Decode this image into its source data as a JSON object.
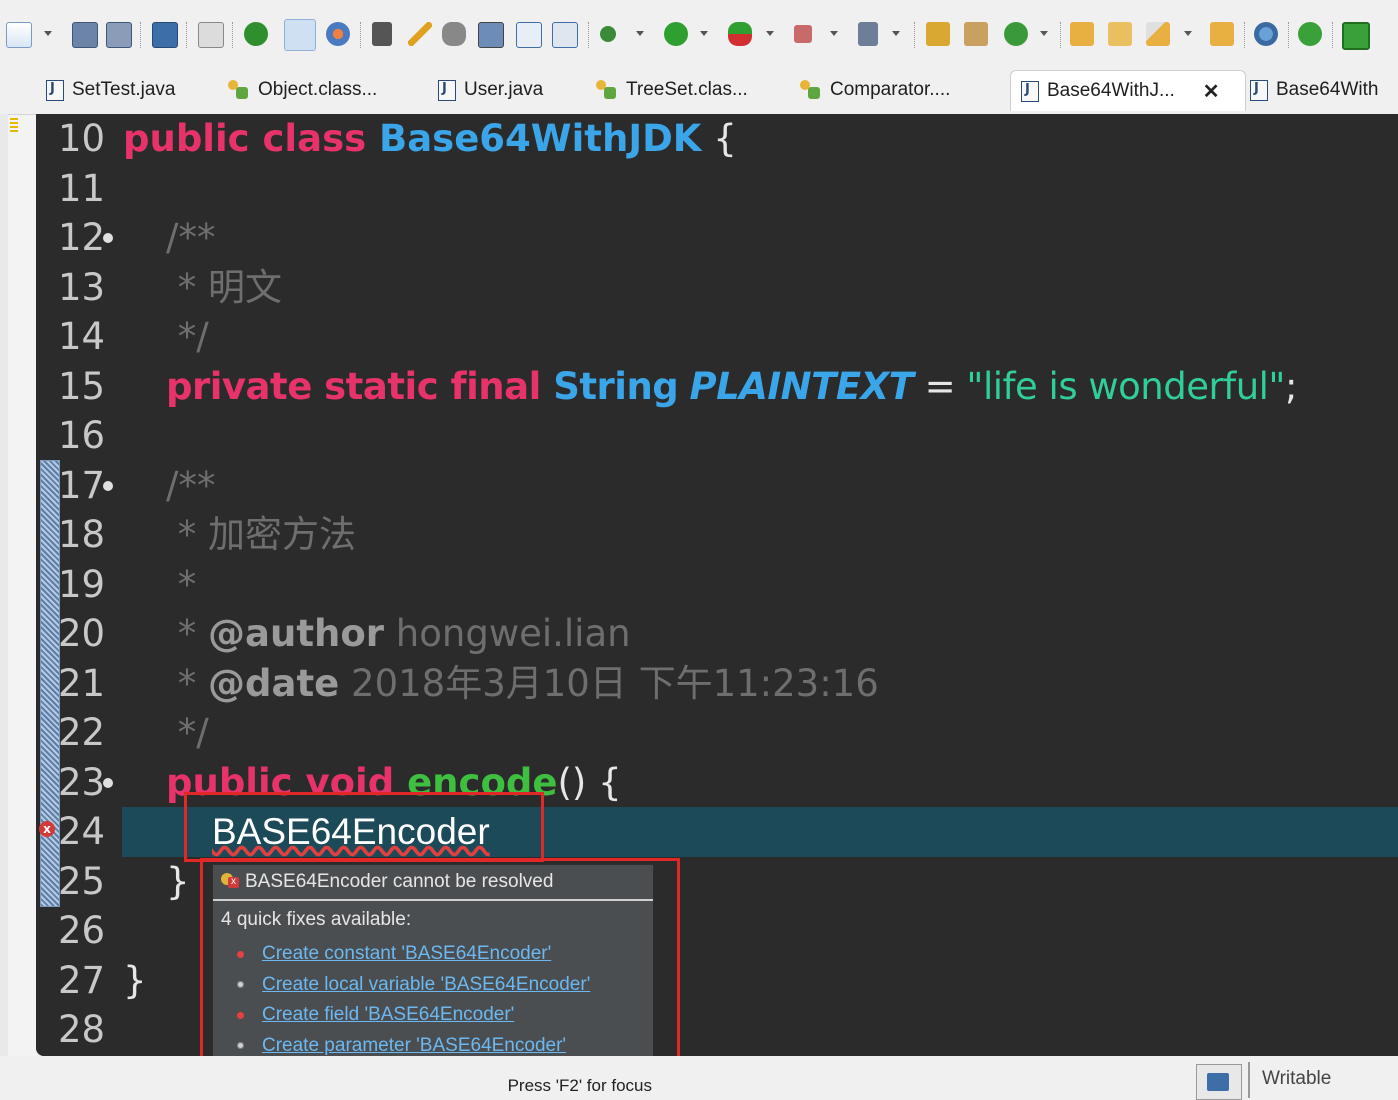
{
  "toolbar": {
    "icons": [
      "new-icon",
      "save-icon",
      "save-all-icon",
      "console-icon",
      "skip-breakpoints-icon",
      "power-icon",
      "toggle-mark-occurrences-icon",
      "web-browser-icon",
      "quick-access-icon",
      "pen-icon",
      "search-icon",
      "open-type-icon",
      "open-task-icon",
      "show-whitespace-icon",
      "debug-icon",
      "run-icon",
      "run-external-icon",
      "stop-icon",
      "next-annotation-icon",
      "new-java-project-icon",
      "new-package-icon",
      "new-class-icon",
      "open-folder-icon",
      "open-project-icon",
      "brush-icon",
      "folder-open-icon",
      "globe-icon",
      "green-circle-icon",
      "terminal-icon"
    ]
  },
  "tabs": [
    {
      "label": "SetTest.java",
      "icon": "java-file-icon"
    },
    {
      "label": "Object.class...",
      "icon": "class-file-icon"
    },
    {
      "label": "User.java",
      "icon": "java-file-icon"
    },
    {
      "label": "TreeSet.clas...",
      "icon": "class-file-icon"
    },
    {
      "label": "Comparator....",
      "icon": "class-file-icon"
    },
    {
      "label": "Base64WithJ...",
      "icon": "java-error-file-icon",
      "close": "✕"
    },
    {
      "label": "Base64With",
      "icon": "java-file-icon"
    }
  ],
  "editor": {
    "line_numbers": [
      "10",
      "11",
      "12",
      "13",
      "14",
      "15",
      "16",
      "17",
      "18",
      "19",
      "20",
      "21",
      "22",
      "23",
      "24",
      "25",
      "26",
      "27",
      "28"
    ],
    "l10": {
      "kw": "public class ",
      "cls": "Base64WithJDK",
      "rest": " {"
    },
    "l12": "/**",
    "l13": " * 明文",
    "l14": " */",
    "l15": {
      "kw": "private static final ",
      "type": "String",
      "sp": " ",
      "const": "PLAINTEXT",
      "eq": " = ",
      "str": "\"life is wonderful\"",
      "semi": ";"
    },
    "l17": "/**",
    "l18": " * 加密方法",
    "l19": " *",
    "l20": {
      "star": " * ",
      "tag": "@author",
      "text": " hongwei.lian"
    },
    "l21": {
      "star": " * ",
      "tag": "@date",
      "text": " 2018年3月10日 下午11:23:16"
    },
    "l22": " */",
    "l23": {
      "kw": "public void ",
      "method": "encode",
      "rest": "() {"
    },
    "l24": "BASE64Encoder",
    "l25": "}",
    "l27": "}"
  },
  "popup": {
    "title": "BASE64Encoder cannot be resolved",
    "subtitle": "4 quick fixes available:",
    "fixes": [
      {
        "label": "Create constant 'BASE64Encoder'",
        "bullet": "red"
      },
      {
        "label": "Create local variable 'BASE64Encoder'",
        "bullet": "grey"
      },
      {
        "label": "Create field 'BASE64Encoder'",
        "bullet": "red"
      },
      {
        "label": "Create parameter 'BASE64Encoder'",
        "bullet": "grey"
      }
    ],
    "focus_hint": "Press 'F2' for focus"
  },
  "status": {
    "writable": "Writable"
  },
  "colors": {
    "keyword": "#e8336a",
    "type": "#3aa5e8",
    "string": "#2fce9a",
    "comment": "#6e6e6e",
    "method": "#3fbf3f",
    "highlight_line": "#1c4a58",
    "annotation_box": "#e02828"
  }
}
